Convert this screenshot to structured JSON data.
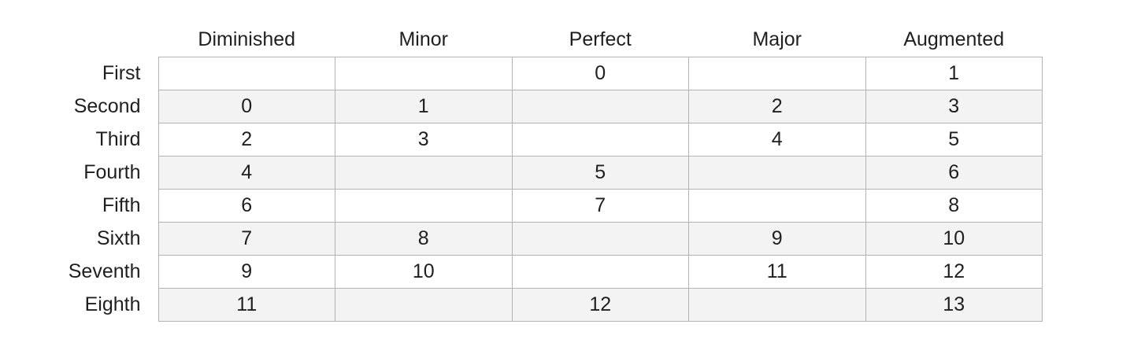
{
  "table": {
    "columns": [
      "Diminished",
      "Minor",
      "Perfect",
      "Major",
      "Augmented"
    ],
    "rows": [
      {
        "label": "First",
        "cells": [
          "",
          "",
          "0",
          "",
          "1"
        ]
      },
      {
        "label": "Second",
        "cells": [
          "0",
          "1",
          "",
          "2",
          "3"
        ]
      },
      {
        "label": "Third",
        "cells": [
          "2",
          "3",
          "",
          "4",
          "5"
        ]
      },
      {
        "label": "Fourth",
        "cells": [
          "4",
          "",
          "5",
          "",
          "6"
        ]
      },
      {
        "label": "Fifth",
        "cells": [
          "6",
          "",
          "7",
          "",
          "8"
        ]
      },
      {
        "label": "Sixth",
        "cells": [
          "7",
          "8",
          "",
          "9",
          "10"
        ]
      },
      {
        "label": "Seventh",
        "cells": [
          "9",
          "10",
          "",
          "11",
          "12"
        ]
      },
      {
        "label": "Eighth",
        "cells": [
          "11",
          "",
          "12",
          "",
          "13"
        ]
      }
    ]
  }
}
